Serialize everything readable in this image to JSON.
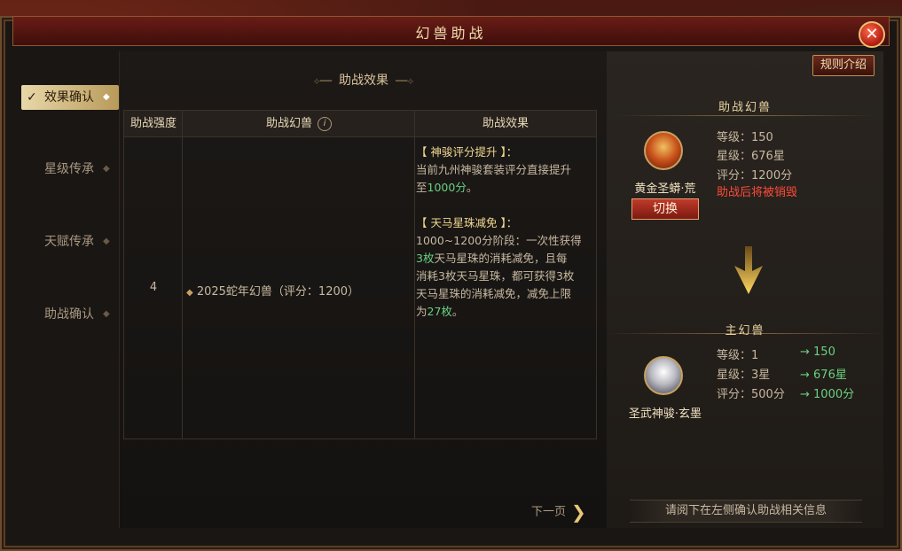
{
  "window": {
    "title": "幻兽助战",
    "close_glyph": "✕"
  },
  "nav": {
    "check_glyph": "✓",
    "items": [
      {
        "label": "效果确认",
        "active": true
      },
      {
        "label": "星级传承",
        "active": false
      },
      {
        "label": "天赋传承",
        "active": false
      },
      {
        "label": "助战确认",
        "active": false
      }
    ]
  },
  "main": {
    "section_title": "助战效果",
    "table": {
      "headers": [
        "助战强度",
        "助战幻兽",
        "助战效果"
      ],
      "info_glyph": "i",
      "row": {
        "strength": "4",
        "beast": "2025蛇年幻兽（评分：1200）"
      },
      "effect": {
        "head1": "【 神骏评分提升 】：",
        "line1a": "当前九州神骏套装评分直接提升",
        "line1b_pre": "至",
        "line1b_val": "1000分",
        "line1b_post": "。",
        "head2": "【 天马星珠减免 】：",
        "p1": "1000~1200分阶段：一次性获得",
        "p2_val": "3枚",
        "p2": "天马星珠的消耗减免，且每",
        "p3": "消耗3枚天马星珠，都可获得3枚",
        "p4": "天马星珠的消耗减免，减免上限",
        "p5_pre": "为",
        "p5_val": "27枚",
        "p5_post": "。"
      }
    },
    "next_label": "下一页",
    "next_glyph": "❯"
  },
  "right": {
    "rules_label": "规则介绍",
    "assist_head": "助战幻兽",
    "assist": {
      "name": "黄金圣蟒·荒",
      "level": "等级：150",
      "star": "星级：676星",
      "score": "评分：1200分",
      "warning": "助战后将被销毁",
      "switch_label": "切换"
    },
    "main_head": "主幻兽",
    "main_beast": {
      "name": "圣武神骏·玄墨",
      "level": "等级：1",
      "level_to": "→  150",
      "star": "星级：3星",
      "star_to": "→  676星",
      "score": "评分：500分",
      "score_to": "→  1000分"
    },
    "footer": "请阅下在左侧确认助战相关信息"
  },
  "colors": {
    "accent_gold": "#e8c878",
    "highlight_green": "#6ad080",
    "warning_red": "#ff4a3a"
  }
}
